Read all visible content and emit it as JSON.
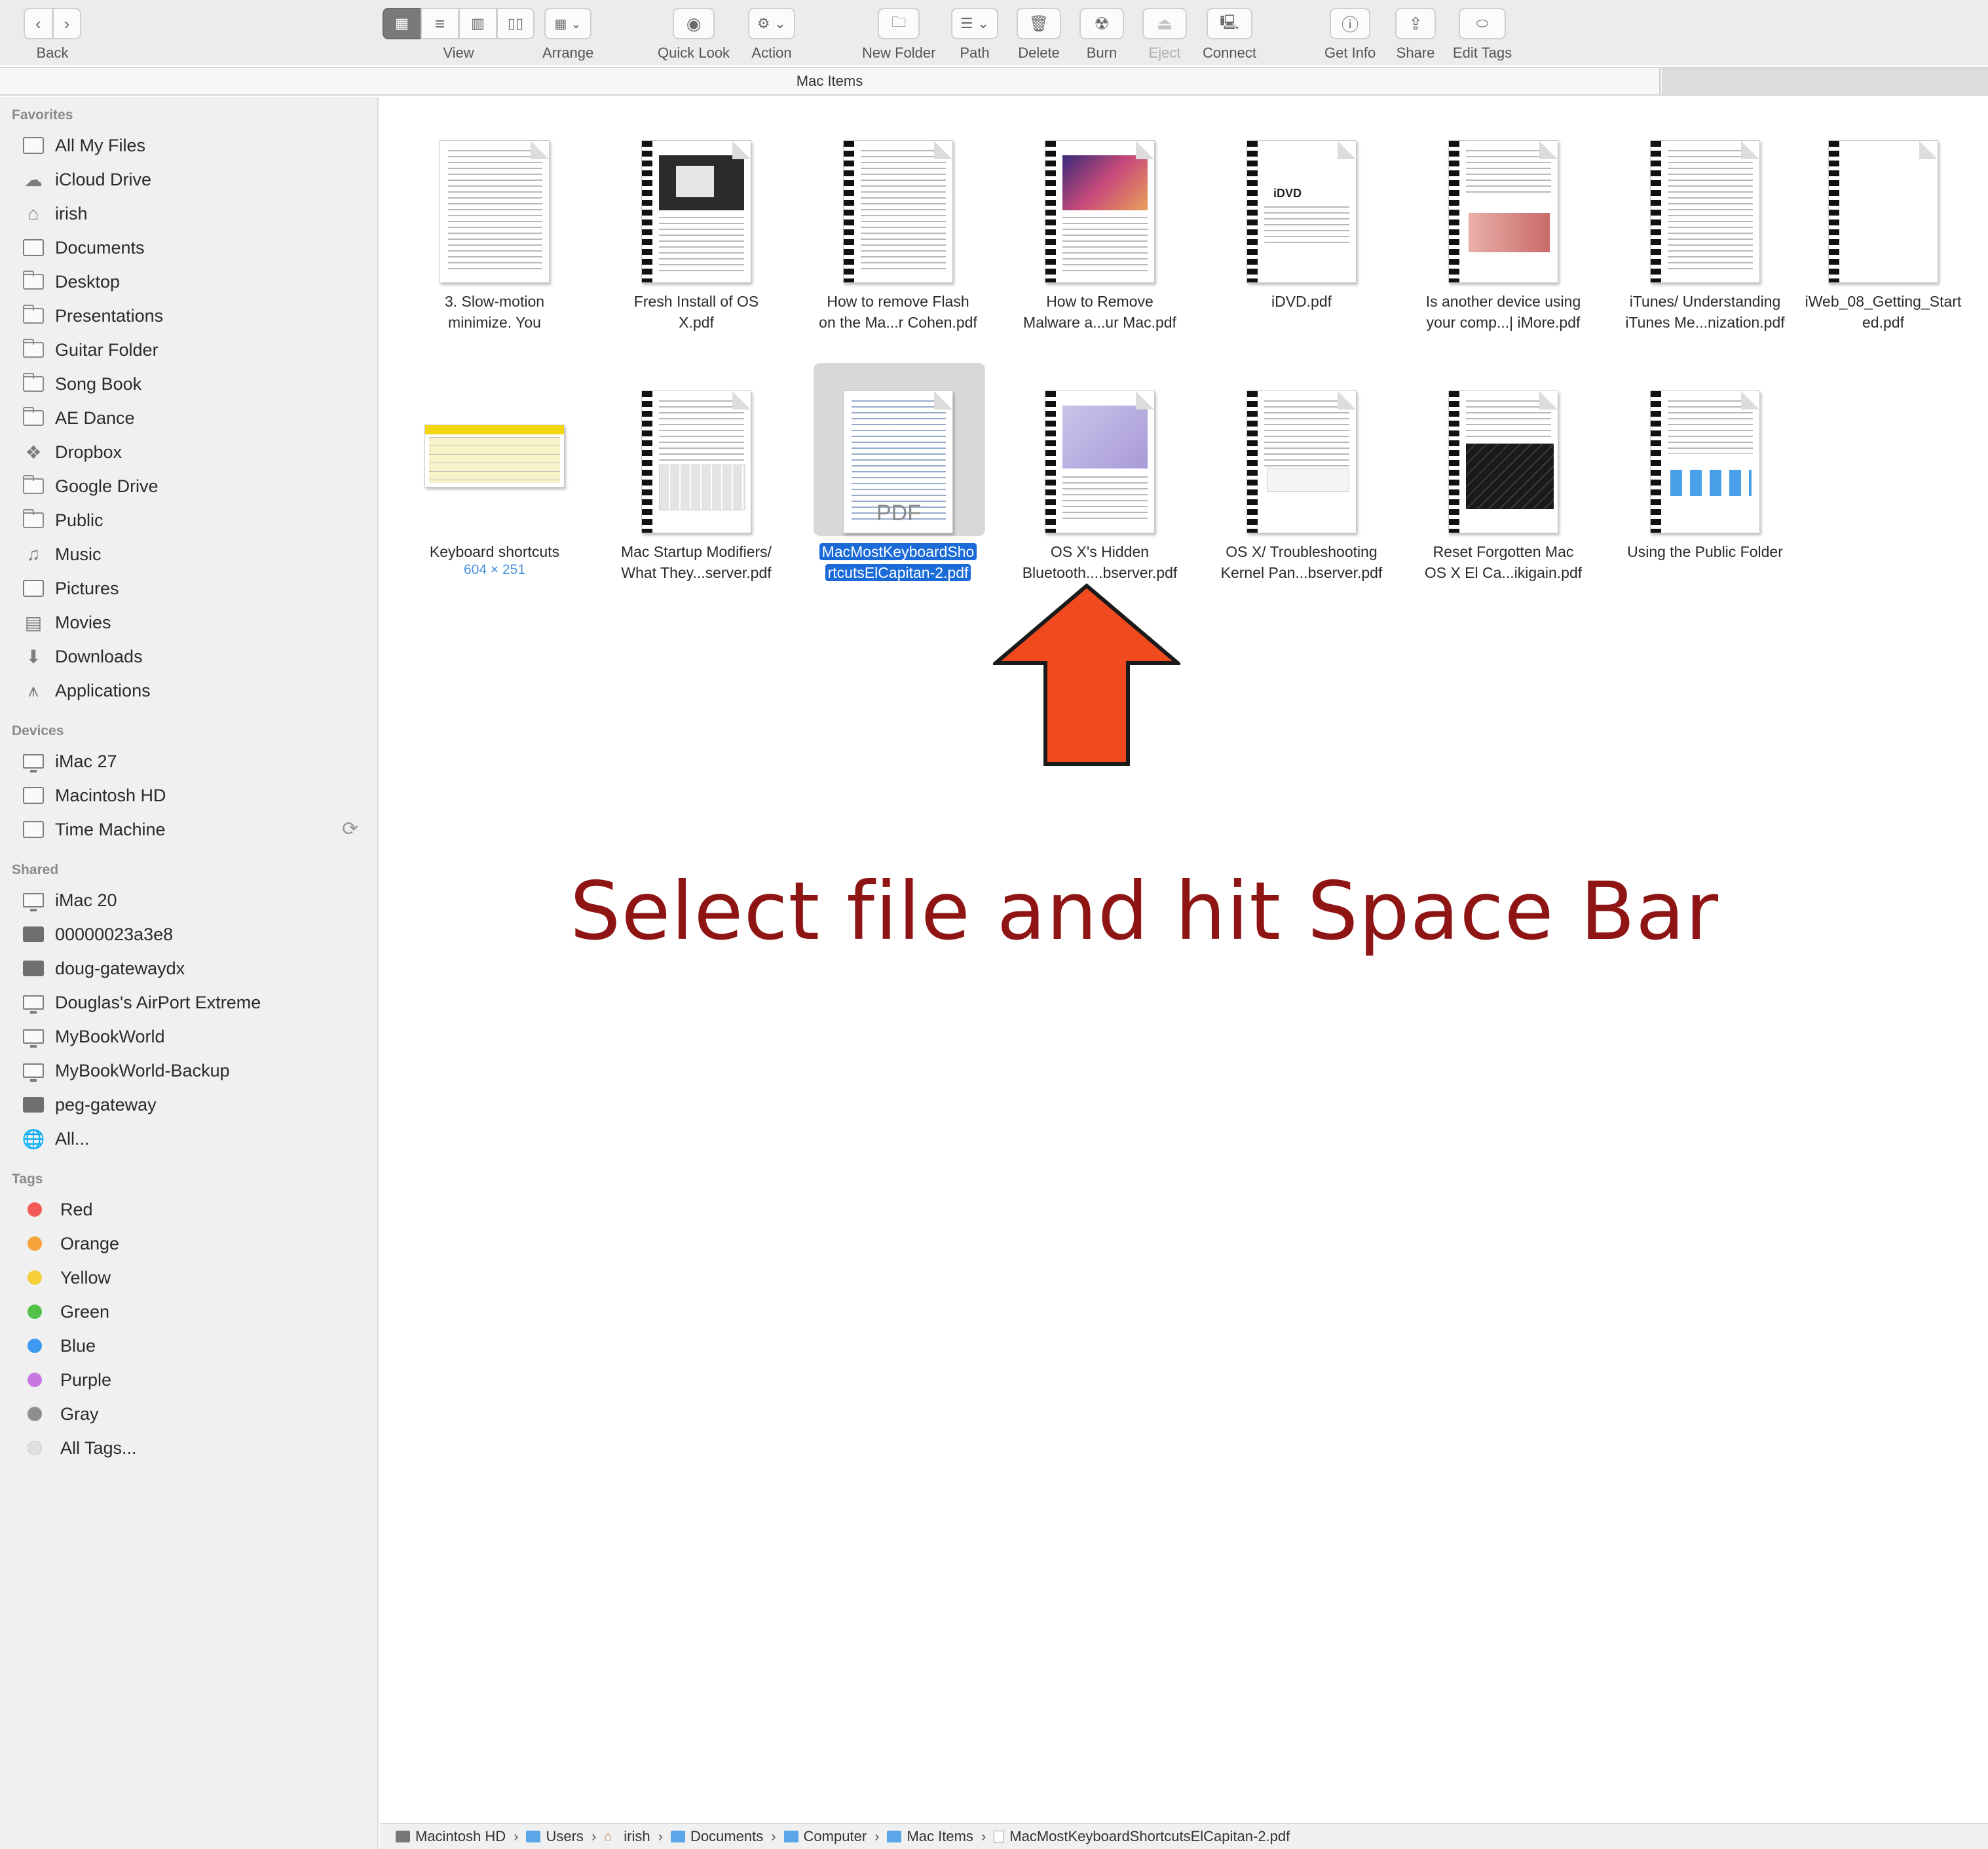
{
  "toolbar": {
    "back_label": "Back",
    "view_label": "View",
    "arrange_label": "Arrange",
    "quicklook_label": "Quick Look",
    "action_label": "Action",
    "newfolder_label": "New Folder",
    "path_label": "Path",
    "delete_label": "Delete",
    "burn_label": "Burn",
    "eject_label": "Eject",
    "connect_label": "Connect",
    "getinfo_label": "Get Info",
    "share_label": "Share",
    "edittags_label": "Edit Tags"
  },
  "window": {
    "title": "Mac Items"
  },
  "sidebar": {
    "favorites_header": "Favorites",
    "favorites": [
      {
        "label": "All My Files",
        "icon": "all-files-icon"
      },
      {
        "label": "iCloud Drive",
        "icon": "cloud-icon"
      },
      {
        "label": "irish",
        "icon": "home-icon"
      },
      {
        "label": "Documents",
        "icon": "documents-icon"
      },
      {
        "label": "Desktop",
        "icon": "folder-icon"
      },
      {
        "label": "Presentations",
        "icon": "folder-icon"
      },
      {
        "label": "Guitar Folder",
        "icon": "folder-icon"
      },
      {
        "label": "Song Book",
        "icon": "folder-icon"
      },
      {
        "label": "AE Dance",
        "icon": "folder-icon"
      },
      {
        "label": "Dropbox",
        "icon": "dropbox-icon"
      },
      {
        "label": "Google Drive",
        "icon": "folder-icon"
      },
      {
        "label": "Public",
        "icon": "folder-icon"
      },
      {
        "label": "Music",
        "icon": "music-icon"
      },
      {
        "label": "Pictures",
        "icon": "camera-icon"
      },
      {
        "label": "Movies",
        "icon": "film-icon"
      },
      {
        "label": "Downloads",
        "icon": "download-icon"
      },
      {
        "label": "Applications",
        "icon": "applications-icon"
      }
    ],
    "devices_header": "Devices",
    "devices": [
      {
        "label": "iMac 27",
        "icon": "imac-icon"
      },
      {
        "label": "Macintosh HD",
        "icon": "disk-icon"
      },
      {
        "label": "Time Machine",
        "icon": "time-machine-icon"
      }
    ],
    "shared_header": "Shared",
    "shared": [
      {
        "label": "iMac 20",
        "icon": "imac-icon"
      },
      {
        "label": "00000023a3e8",
        "icon": "server-icon"
      },
      {
        "label": "doug-gatewaydx",
        "icon": "server-icon"
      },
      {
        "label": "Douglas's AirPort Extreme",
        "icon": "imac-icon"
      },
      {
        "label": "MyBookWorld",
        "icon": "imac-icon"
      },
      {
        "label": "MyBookWorld-Backup",
        "icon": "imac-icon"
      },
      {
        "label": "peg-gateway",
        "icon": "server-icon"
      },
      {
        "label": "All...",
        "icon": "network-globe-icon"
      }
    ],
    "tags_header": "Tags",
    "tags": [
      {
        "label": "Red",
        "color": "#f25a55"
      },
      {
        "label": "Orange",
        "color": "#f7a23b"
      },
      {
        "label": "Yellow",
        "color": "#f5d03b"
      },
      {
        "label": "Green",
        "color": "#52c14a"
      },
      {
        "label": "Blue",
        "color": "#3d9af2"
      },
      {
        "label": "Purple",
        "color": "#c678e0"
      },
      {
        "label": "Gray",
        "color": "#8e8e8e"
      },
      {
        "label": "All Tags...",
        "color": "#e0e0e0"
      }
    ]
  },
  "files": [
    {
      "line1": "3. Slow-motion",
      "line2": "minimize. You"
    },
    {
      "line1": "Fresh Install of OS",
      "line2": "X.pdf"
    },
    {
      "line1": "How to remove Flash",
      "line2": "on the Ma...r Cohen.pdf"
    },
    {
      "line1": "How to Remove",
      "line2": "Malware a...ur Mac.pdf"
    },
    {
      "line1": "iDVD.pdf",
      "line2": ""
    },
    {
      "line1": "Is another device using",
      "line2": "your comp...| iMore.pdf"
    },
    {
      "line1": "iTunes/ Understanding",
      "line2": "iTunes Me...nization.pdf"
    },
    {
      "line1": "iWeb_08_Getting_Start",
      "line2": "ed.pdf"
    },
    {
      "line1": "Keyboard shortcuts",
      "line2": "604 × 251"
    },
    {
      "line1": "Mac Startup Modifiers/",
      "line2": "What They...server.pdf"
    },
    {
      "line1": "MacMostKeyboardSho",
      "line2": "rtcutsElCapitan-2.pdf"
    },
    {
      "line1": "OS X's Hidden",
      "line2": "Bluetooth....bserver.pdf"
    },
    {
      "line1": "OS X/ Troubleshooting",
      "line2": "Kernel Pan...bserver.pdf"
    },
    {
      "line1": "Reset Forgotten Mac",
      "line2": "OS X El Ca...ikigain.pdf"
    },
    {
      "line1": "Using the Public Folder",
      "line2": ""
    }
  ],
  "thumb_pdf_text": "PDF",
  "annotation": {
    "text": "Select file and hit Space Bar",
    "arrow_color": "#f24a1f"
  },
  "pathbar": [
    {
      "label": "Macintosh HD",
      "icon": "disk-icon"
    },
    {
      "label": "Users",
      "icon": "folder-icon"
    },
    {
      "label": "irish",
      "icon": "home-icon"
    },
    {
      "label": "Documents",
      "icon": "folder-icon"
    },
    {
      "label": "Computer",
      "icon": "folder-icon"
    },
    {
      "label": "Mac Items",
      "icon": "folder-icon"
    },
    {
      "label": "MacMostKeyboardShortcutsElCapitan-2.pdf",
      "icon": "pdf-file-icon"
    }
  ],
  "pathbar_separator": "›"
}
